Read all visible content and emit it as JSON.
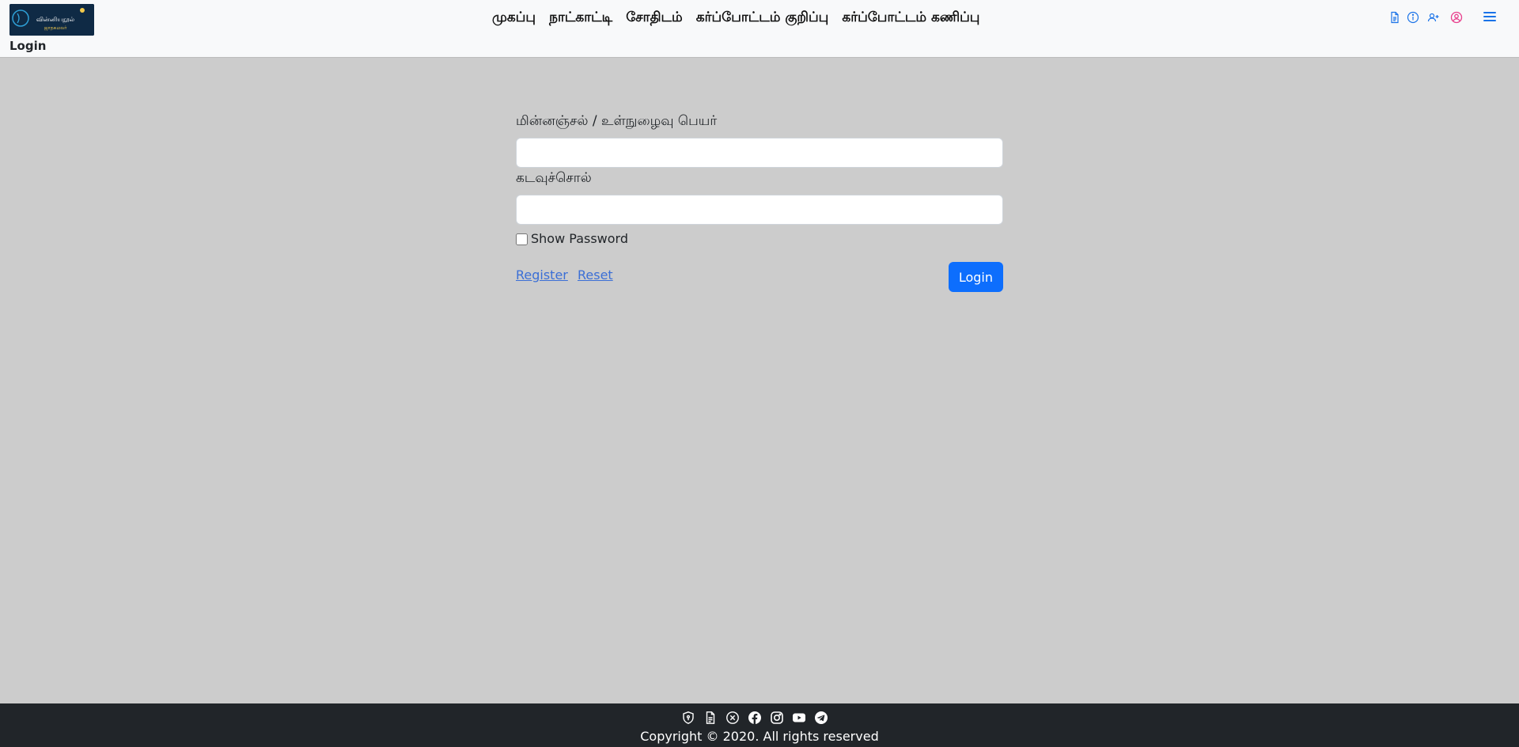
{
  "header": {
    "logo_text": "வின்னியநூல்",
    "logo_subtext": "ஜாதகமலர்",
    "page_label": "Login",
    "nav": [
      {
        "label": "முகப்பு"
      },
      {
        "label": "நாட்காட்டி"
      },
      {
        "label": "சோதிடம்"
      },
      {
        "label": "கர்ப்போட்டம் குறிப்பு"
      },
      {
        "label": "கர்ப்போட்டம் கணிப்பு"
      }
    ],
    "icons": [
      "document-icon",
      "info-icon",
      "add-user-icon",
      "user-circle-icon",
      "menu-icon"
    ]
  },
  "form": {
    "username_label": "மின்னஞ்சல் / உள்நுழைவு பெயர்",
    "username_value": "",
    "password_label": "கடவுச்சொல்",
    "password_value": "",
    "show_password_label": "Show Password",
    "register_label": "Register",
    "reset_label": "Reset",
    "login_label": "Login"
  },
  "footer": {
    "icons": [
      "shield-icon",
      "document-icon",
      "x-circle-icon",
      "facebook-icon",
      "instagram-icon",
      "youtube-icon",
      "telegram-icon"
    ],
    "copyright": "Copyright © 2020. All rights reserved"
  },
  "colors": {
    "accent": "#0d6efd",
    "link": "#3b6fd6",
    "icon_blue": "#1a73e8",
    "icon_pink": "#e83e8c",
    "page_bg": "#cccccc",
    "footer_bg": "#212529"
  }
}
